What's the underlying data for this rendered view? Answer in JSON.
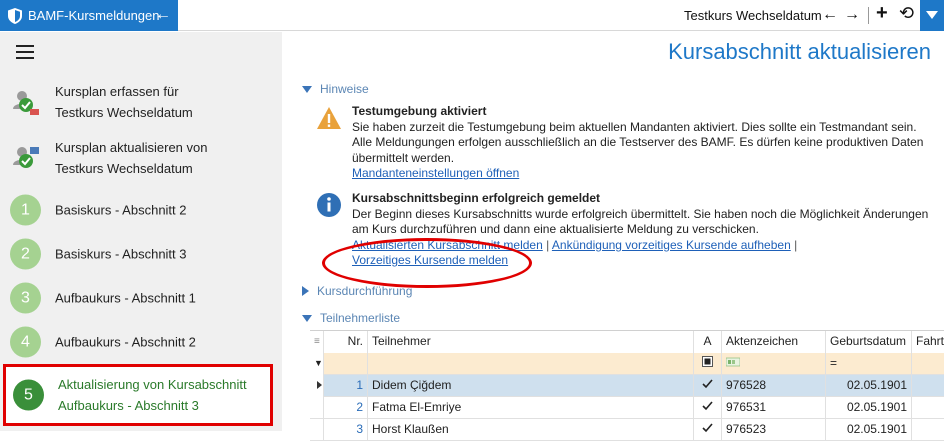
{
  "titlebar": {
    "app_title": "BAMF-Kursmeldungen",
    "course_name": "Testkurs Wechseldatum",
    "brand_color": "#1e78c8"
  },
  "sidebar": {
    "items": [
      {
        "line1": "Kursplan erfassen für",
        "line2": "Testkurs Wechseldatum",
        "icon": "plan-create-icon"
      },
      {
        "line1": "Kursplan aktualisieren von",
        "line2": "Testkurs Wechseldatum",
        "icon": "plan-update-icon"
      },
      {
        "number": "1",
        "label": "Basiskurs - Abschnitt 2"
      },
      {
        "number": "2",
        "label": "Basiskurs - Abschnitt 3"
      },
      {
        "number": "3",
        "label": "Aufbaukurs - Abschnitt 1"
      },
      {
        "number": "4",
        "label": "Aufbaukurs - Abschnitt 2"
      },
      {
        "number": "5",
        "line1": "Aktualisierung von Kursabschnitt",
        "line2": "Aufbaukurs - Abschnitt 3",
        "active": true
      }
    ]
  },
  "main": {
    "page_title": "Kursabschnitt aktualisieren",
    "sections": {
      "hinweise": "Hinweise",
      "kursdurchfuehrung": "Kursdurchführung",
      "teilnehmerliste": "Teilnehmerliste"
    },
    "warning": {
      "title": "Testumgebung aktiviert",
      "line1": "Sie haben zurzeit die Testumgebung beim aktuellen Mandanten aktiviert. Dies sollte ein Testmandant sein.",
      "line2": "Alle Meldungungen erfolgen ausschließlich an die Testserver des BAMF. Es dürfen keine produktiven Daten",
      "line3": "übermittelt werden.",
      "link": "Mandanteneinstellungen öffnen"
    },
    "info": {
      "title": "Kursabschnittsbeginn erfolgreich gemeldet",
      "line1": "Der Beginn dieses Kursabschnitts wurde erfolgreich übermittelt. Sie haben noch die Möglichkeit Änderungen",
      "line2": "am Kurs durchzuführen und dann eine aktualisierte Meldung zu verschicken.",
      "link1": "Aktualisierten Kursabschnitt melden",
      "link2": "Ankündigung vorzeitiges Kursende aufheben",
      "link3": "Vorzeitiges Kursende melden",
      "separator": "|"
    }
  },
  "grid": {
    "columns": [
      "Nr.",
      "Teilnehmer",
      "A",
      "Aktenzeichen",
      "Geburtsdatum",
      "Fahrtko"
    ],
    "filter_equals": "=",
    "rows": [
      {
        "nr": "1",
        "name": "Didem Çiğdem",
        "a": true,
        "aktenzeichen": "976528",
        "geburtsdatum": "02.05.1901"
      },
      {
        "nr": "2",
        "name": "Fatma El-Emriye",
        "a": true,
        "aktenzeichen": "976531",
        "geburtsdatum": "02.05.1901"
      },
      {
        "nr": "3",
        "name": "Horst Klaußen",
        "a": true,
        "aktenzeichen": "976523",
        "geburtsdatum": "02.05.1901"
      }
    ]
  }
}
